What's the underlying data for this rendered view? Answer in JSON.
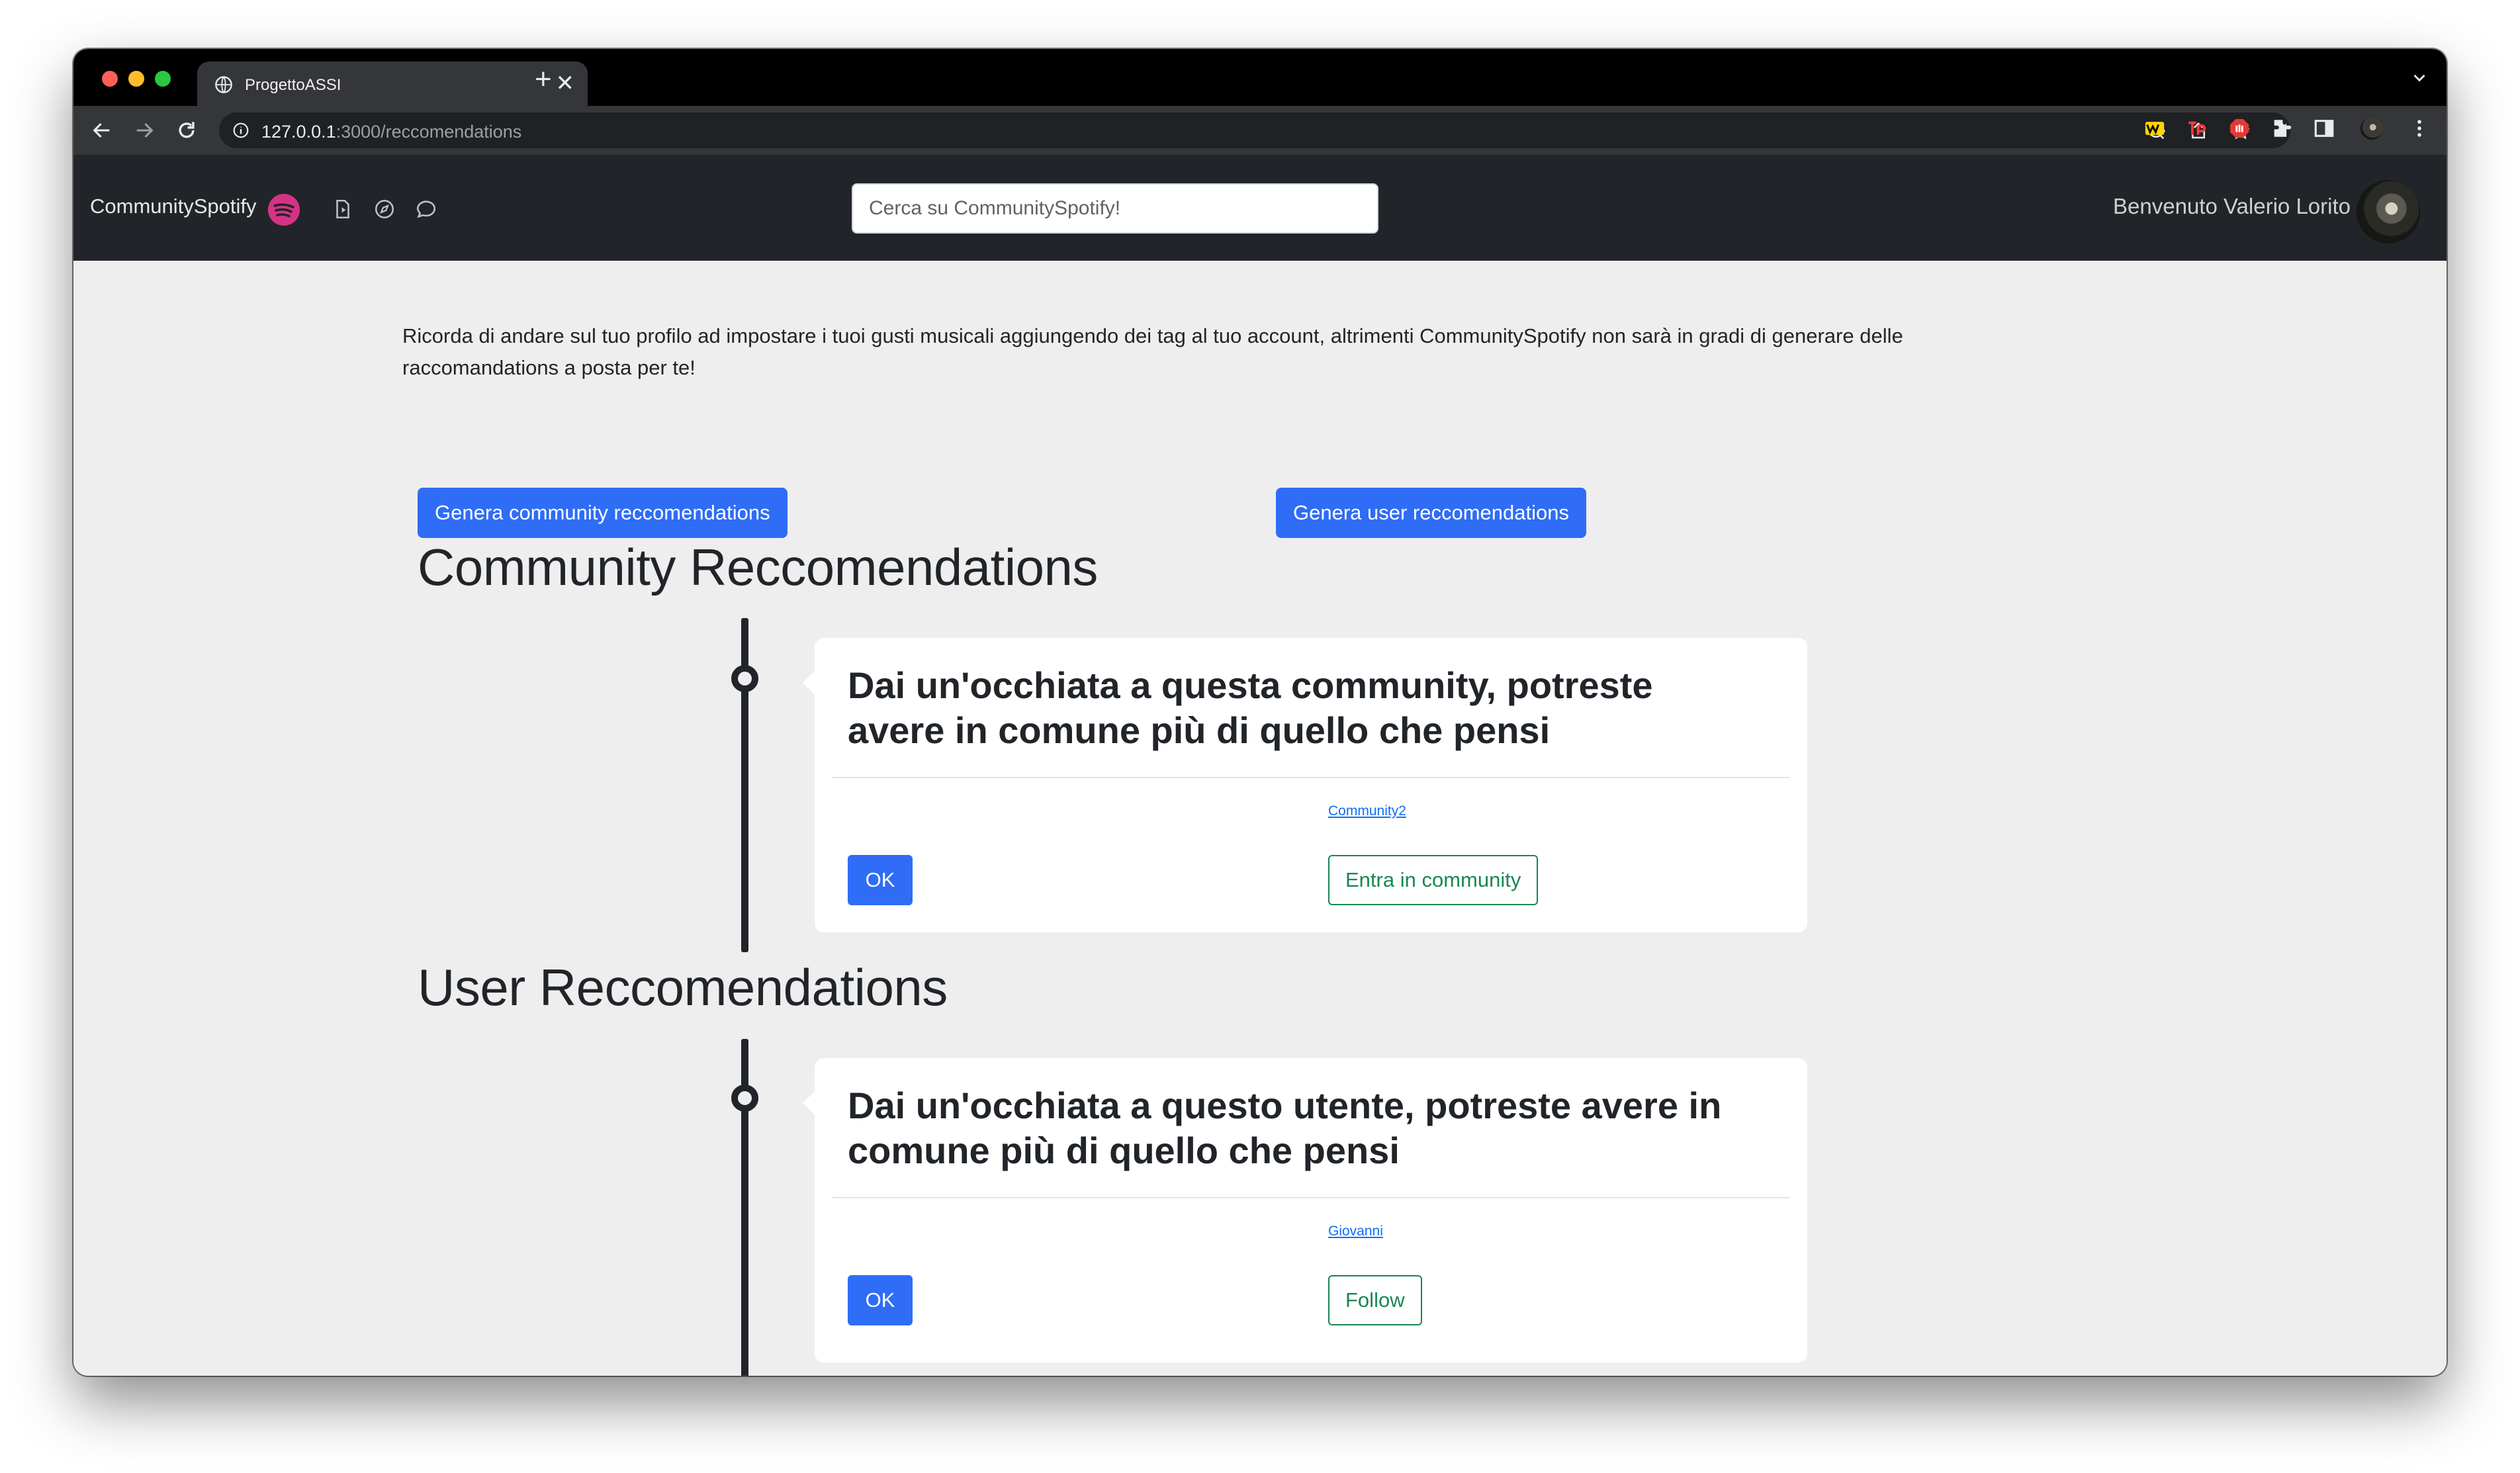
{
  "browser": {
    "tab_title": "ProgettoASSI",
    "url_host": "127.0.0.1",
    "url_rest": ":3000/reccomendations",
    "new_tab": "+",
    "close_tab": "✕"
  },
  "navbar": {
    "brand": "CommunitySpotify",
    "search_placeholder": "Cerca su CommunitySpotify!",
    "welcome": "Benvenuto Valerio Lorito"
  },
  "main": {
    "notice": "Ricorda di andare sul tuo profilo ad impostare i tuoi gusti musicali aggiungendo dei tag al tuo account, altrimenti CommunitySpotify non sarà in gradi di generare delle raccomandations a posta per te!",
    "generate_community_label": "Genera community reccomendations",
    "generate_user_label": "Genera user reccomendations",
    "community_section": {
      "title": "Community Reccomendations",
      "card": {
        "heading": "Dai un'occhiata a questa community, potreste avere in comune più di quello che pensi",
        "link": "Community2",
        "ok_label": "OK",
        "action_label": "Entra in community"
      }
    },
    "user_section": {
      "title": "User Reccomendations",
      "card": {
        "heading": "Dai un'occhiata a questo utente, potreste avere in comune più di quello che pensi",
        "link": "Giovanni",
        "ok_label": "OK",
        "action_label": "Follow"
      }
    }
  },
  "colors": {
    "primary": "#2f6df6",
    "success": "#198754",
    "navbar_bg": "#212529",
    "page_bg": "#eeeeee",
    "brand_accent": "#d63384"
  }
}
